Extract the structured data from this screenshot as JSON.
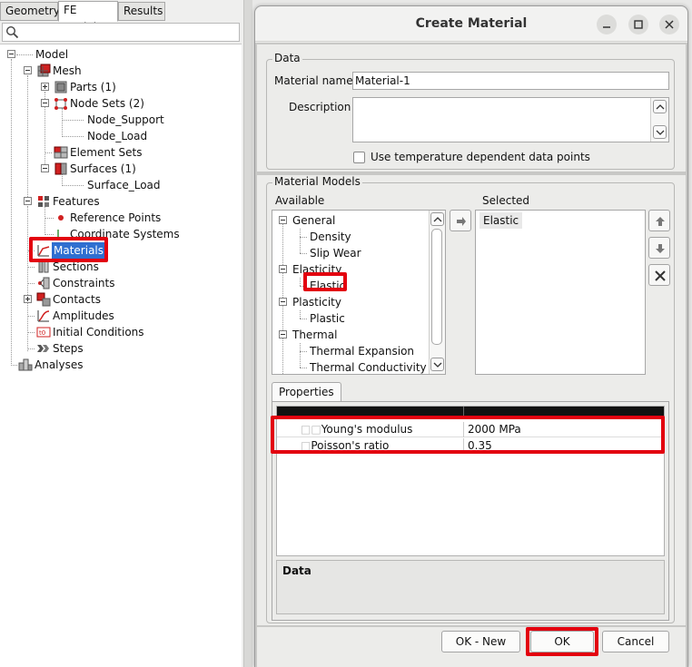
{
  "left_tabs": [
    "Geometry",
    "FE Model",
    "Results"
  ],
  "active_left_tab": "FE Model",
  "tree": {
    "model": "Model",
    "mesh": "Mesh",
    "parts": "Parts (1)",
    "node_sets": "Node Sets (2)",
    "node_support": "Node_Support",
    "node_load": "Node_Load",
    "element_sets": "Element Sets",
    "surfaces": "Surfaces (1)",
    "surface_load": "Surface_Load",
    "features": "Features",
    "reference_points": "Reference Points",
    "coordinate_systems": "Coordinate Systems",
    "materials": "Materials",
    "sections": "Sections",
    "constraints": "Constraints",
    "contacts": "Contacts",
    "amplitudes": "Amplitudes",
    "initial_conditions": "Initial Conditions",
    "steps": "Steps",
    "analyses": "Analyses"
  },
  "dialog": {
    "title": "Create Material",
    "data_group": "Data",
    "material_name_label": "Material name",
    "material_name_value": "Material-1",
    "description_label": "Description",
    "description_value": "",
    "temp_checkbox_label": "Use temperature dependent data points",
    "temp_checkbox_checked": false,
    "material_models_group": "Material Models",
    "available_label": "Available",
    "selected_label": "Selected",
    "available": {
      "general": "General",
      "density": "Density",
      "slip_wear": "Slip Wear",
      "elasticity": "Elasticity",
      "elastic": "Elastic",
      "plasticity": "Plasticity",
      "plastic": "Plastic",
      "thermal": "Thermal",
      "thermal_expansion": "Thermal Expansion",
      "thermal_conductivity": "Thermal Conductivity"
    },
    "selected_items": [
      "Elastic"
    ],
    "properties_tab": "Properties",
    "properties": [
      {
        "name": "Young's modulus",
        "value": "2000 MPa"
      },
      {
        "name": "Poisson's ratio",
        "value": "0.35"
      }
    ],
    "data_footer_label": "Data",
    "buttons": {
      "ok_new": "OK - New",
      "ok": "OK",
      "cancel": "Cancel"
    }
  },
  "colors": {
    "highlight_box": "#e3000f",
    "selection": "#2f6fd0"
  }
}
